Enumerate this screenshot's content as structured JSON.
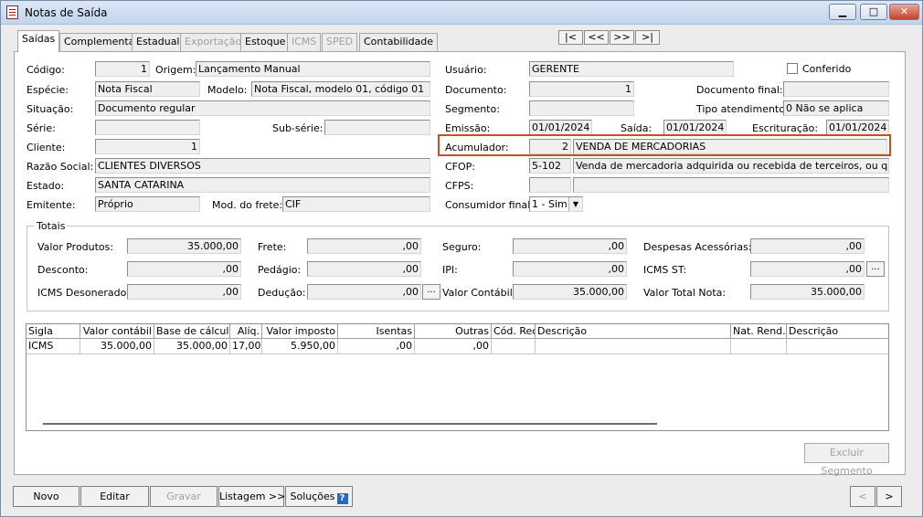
{
  "window": {
    "title": "Notas de Saída"
  },
  "tabs": [
    "Saídas",
    "Complementar",
    "Estadual",
    "Exportação",
    "Estoque",
    "ICMS",
    "SPED",
    "Contabilidade"
  ],
  "nav": [
    "|<",
    "<<",
    ">>",
    ">|"
  ],
  "left": {
    "codigo_label": "Código:",
    "codigo": "1",
    "origem_label": "Origem:",
    "origem": "Lançamento Manual",
    "especie_label": "Espécie:",
    "especie": "Nota Fiscal",
    "modelo_label": "Modelo:",
    "modelo": "Nota Fiscal, modelo 01, código 01",
    "situacao_label": "Situação:",
    "situacao": "Documento regular",
    "serie_label": "Série:",
    "serie": "",
    "subserie_label": "Sub-série:",
    "subserie": "",
    "cliente_label": "Cliente:",
    "cliente": "1",
    "razao_label": "Razão Social:",
    "razao": "CLIENTES DIVERSOS",
    "estado_label": "Estado:",
    "estado": "SANTA CATARINA",
    "emitente_label": "Emitente:",
    "emitente": "Próprio",
    "frete_label": "Mod. do frete:",
    "frete": "CIF"
  },
  "right": {
    "usuario_label": "Usuário:",
    "usuario": "GERENTE",
    "conferido_label": "Conferido",
    "documento_label": "Documento:",
    "documento": "1",
    "docfinal_label": "Documento final:",
    "docfinal": "",
    "segmento_label": "Segmento:",
    "segmento": "",
    "tipoatend_label": "Tipo atendimento:",
    "tipoatend": "0 Não se aplica",
    "emissao_label": "Emissão:",
    "emissao": "01/01/2024",
    "saida_label": "Saída:",
    "saida": "01/01/2024",
    "escrit_label": "Escrituração:",
    "escrit": "01/01/2024",
    "acum_label": "Acumulador:",
    "acum_code": "2",
    "acum_desc": "VENDA DE MERCADORIAS",
    "cfop_label": "CFOP:",
    "cfop_code": "5-102",
    "cfop_desc": "Venda de mercadoria adquirida ou recebida de terceiros, ou qualquer ve",
    "cfps_label": "CFPS:",
    "cfps_code": "",
    "cfps_desc": "",
    "consumidor_label": "Consumidor final:",
    "consumidor": "1 - Sim"
  },
  "totais": {
    "title": "Totais",
    "valor_produtos_label": "Valor Produtos:",
    "valor_produtos": "35.000,00",
    "frete_label": "Frete:",
    "frete": ",00",
    "seguro_label": "Seguro:",
    "seguro": ",00",
    "despesas_label": "Despesas Acessórias:",
    "despesas": ",00",
    "desconto_label": "Desconto:",
    "desconto": ",00",
    "pedagio_label": "Pedágio:",
    "pedagio": ",00",
    "ipi_label": "IPI:",
    "ipi": ",00",
    "icmsst_label": "ICMS ST:",
    "icmsst": ",00",
    "icmsdes_label": "ICMS Desonerado:",
    "icmsdes": ",00",
    "deducao_label": "Dedução:",
    "deducao": ",00",
    "valor_contabil_label": "Valor Contábil:",
    "valor_contabil": "35.000,00",
    "valor_total_label": "Valor Total Nota:",
    "valor_total": "35.000,00",
    "more": "..."
  },
  "grid": {
    "headers": [
      "Sigla",
      "Valor contábil",
      "Base de cálculo",
      "Alíq.",
      "Valor imposto",
      "Isentas",
      "Outras",
      "Cód. Rec.",
      "Descrição",
      "Nat. Rend.",
      "Descrição"
    ],
    "rows": [
      [
        "ICMS",
        "35.000,00",
        "35.000,00",
        "17,00",
        "5.950,00",
        ",00",
        ",00",
        "",
        "",
        "",
        ""
      ]
    ]
  },
  "excluir_label": "Excluir Segmento",
  "buttons": {
    "novo": "Novo",
    "editar": "Editar",
    "gravar": "Gravar",
    "listagem": "Listagem >>",
    "solucoes": "Soluções",
    "help": "?",
    "prev": "<",
    "next": ">"
  }
}
